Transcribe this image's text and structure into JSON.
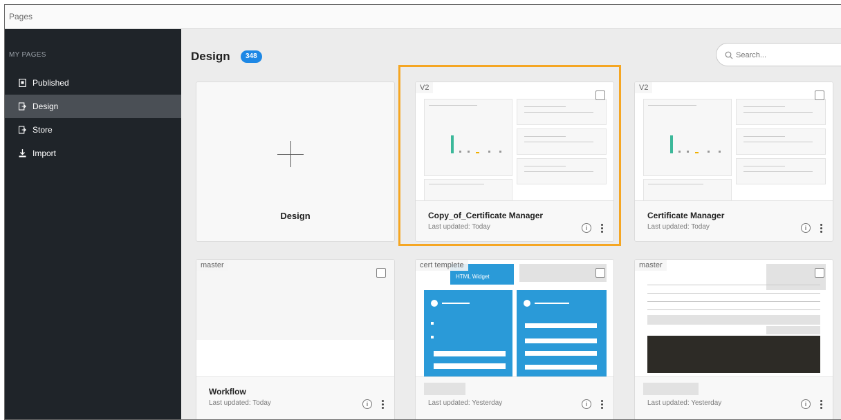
{
  "window": {
    "title": "Pages"
  },
  "sidebar": {
    "heading": "MY PAGES",
    "items": [
      {
        "label": "Published",
        "icon": "published-icon",
        "active": false
      },
      {
        "label": "Design",
        "icon": "design-icon",
        "active": true
      },
      {
        "label": "Store",
        "icon": "store-icon",
        "active": false
      },
      {
        "label": "Import",
        "icon": "import-icon",
        "active": false
      }
    ]
  },
  "main": {
    "title": "Design",
    "count": "348",
    "search": {
      "placeholder": "Search..."
    }
  },
  "cards": [
    {
      "title": "Design",
      "type": "new"
    },
    {
      "title": "Copy_of_Certificate Manager",
      "subtitle": "Last updated: Today",
      "tag": "V2",
      "selected_outline": true
    },
    {
      "title": "Certificate Manager",
      "subtitle": "Last updated: Today",
      "tag": "V2"
    },
    {
      "title": "Workflow",
      "subtitle": "Last updated: Today",
      "tag": "master"
    },
    {
      "title": "",
      "subtitle": "Last updated: Yesterday",
      "tag": "cert templete",
      "thumb_text": "HTML Widget"
    },
    {
      "title": "",
      "subtitle": "Last updated: Yesterday",
      "tag": "master"
    }
  ],
  "colors": {
    "accent": "#1e88e5",
    "highlight": "#f5a623",
    "sidebar_bg": "#1f2429",
    "widget_blue": "#2a9ad8"
  }
}
